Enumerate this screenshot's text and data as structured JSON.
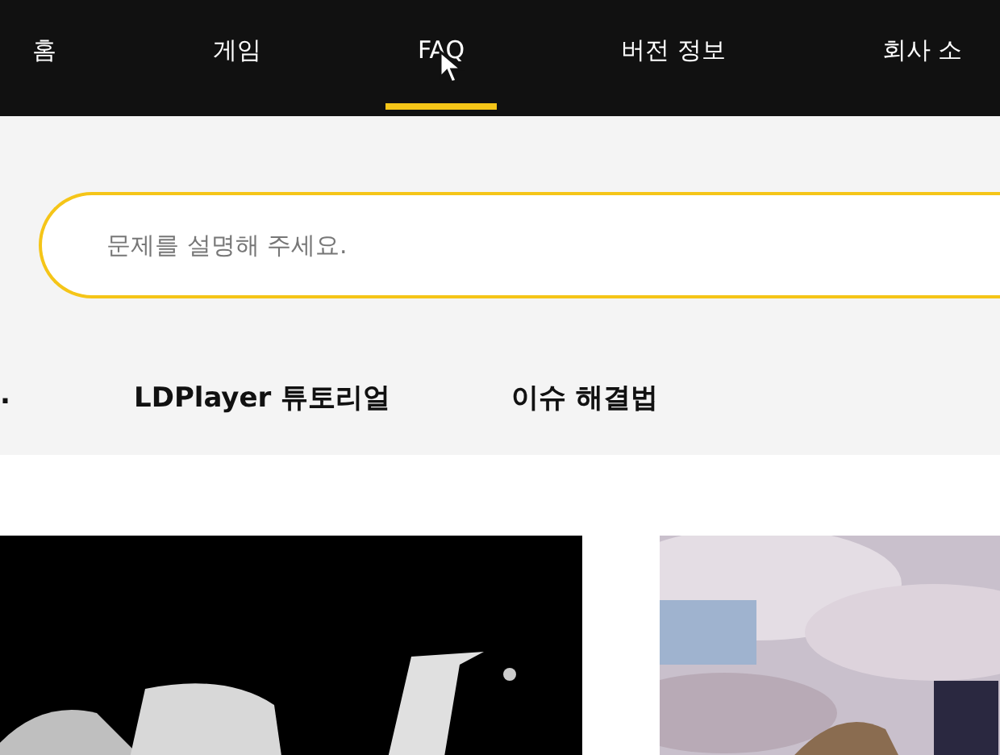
{
  "nav": {
    "tabs": [
      {
        "label": "홈",
        "selected": false
      },
      {
        "label": "게임",
        "selected": false
      },
      {
        "label": "FAQ",
        "selected": true
      },
      {
        "label": "버전 정보",
        "selected": false
      },
      {
        "label": "회사 소",
        "selected": false
      }
    ]
  },
  "search": {
    "placeholder": "문제를 설명해 주세요."
  },
  "categories": [
    ".",
    "LDPlayer 튜토리얼",
    "이슈 해결법"
  ]
}
